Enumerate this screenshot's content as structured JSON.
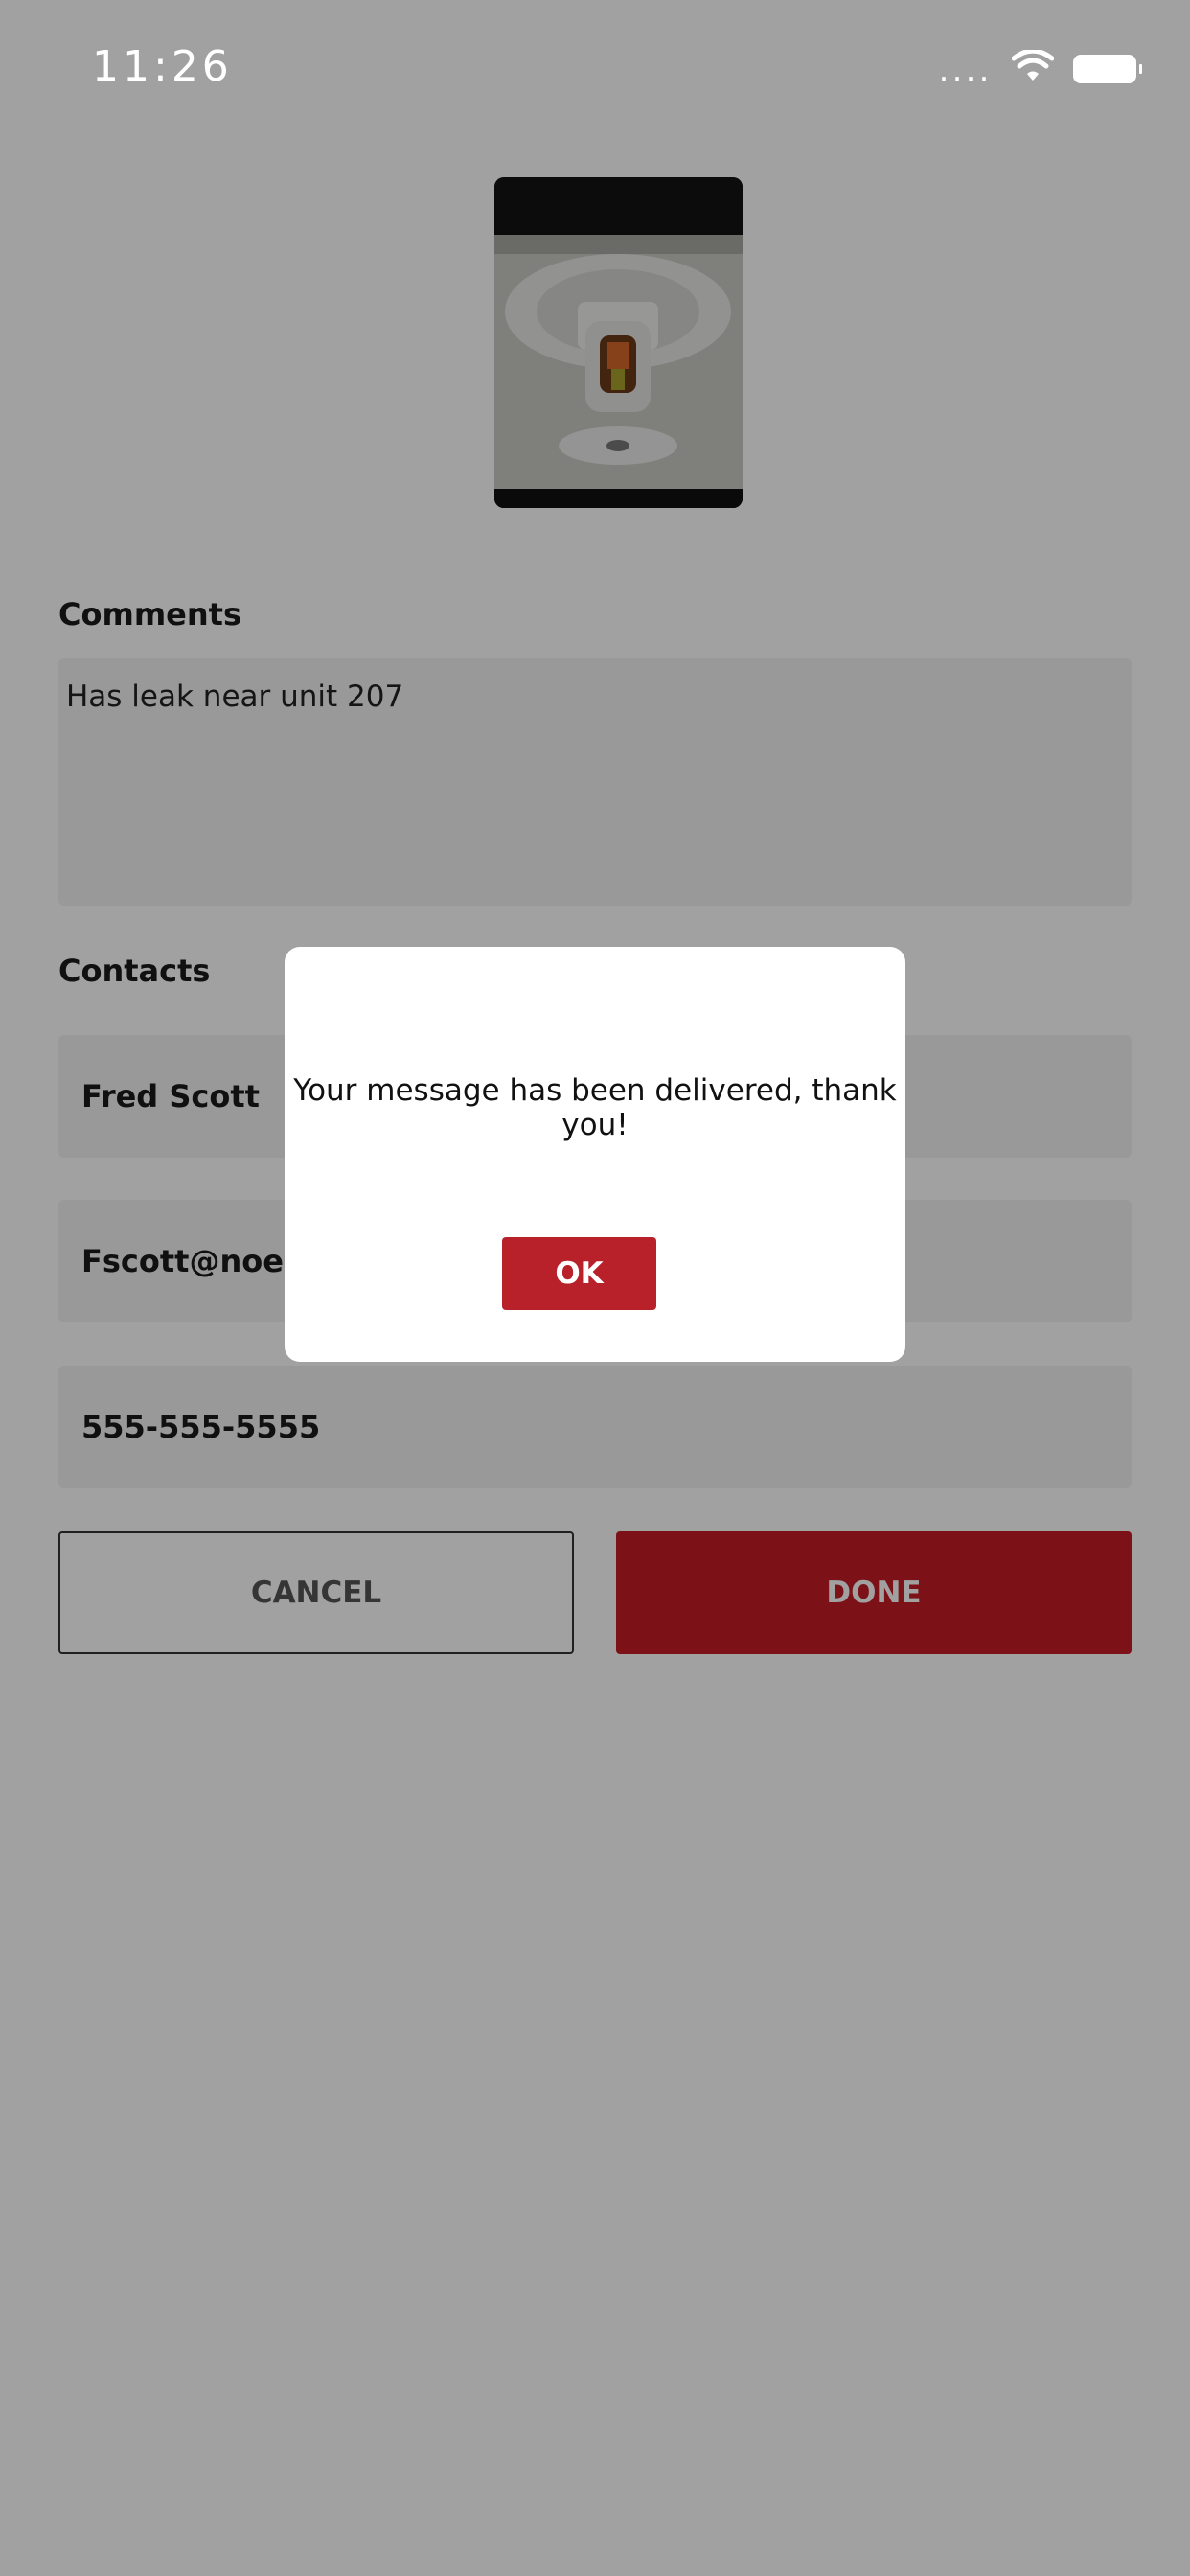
{
  "status_bar": {
    "time": "11:26",
    "signal": "....",
    "wifi_icon": "wifi-icon",
    "battery_icon": "battery-icon"
  },
  "photo": {
    "icon": "sprinkler-photo"
  },
  "comments": {
    "label": "Comments",
    "value": "Has leak near unit 207"
  },
  "contacts": {
    "label": "Contacts",
    "name": "Fred Scott",
    "email": "Fscott@noemail.",
    "phone": "555-555-5555"
  },
  "actions": {
    "cancel_label": "CANCEL",
    "done_label": "DONE"
  },
  "dialog": {
    "message": "Your message has been delivered, thank you!",
    "ok_label": "OK"
  },
  "colors": {
    "accent": "#c41e25",
    "overlay": "#000000"
  }
}
